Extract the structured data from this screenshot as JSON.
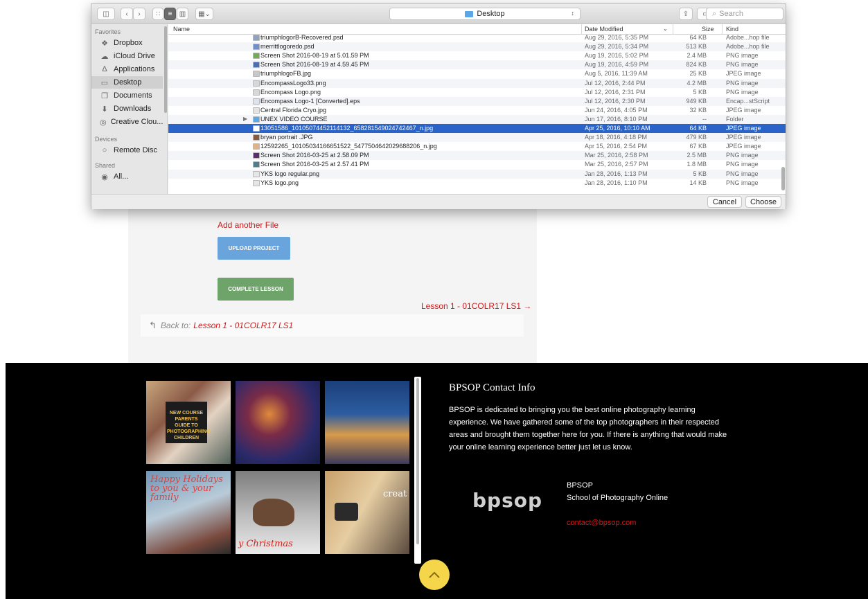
{
  "dialog": {
    "location": "Desktop",
    "search_placeholder": "Search",
    "sidebar": {
      "favorites_header": "Favorites",
      "favorites": [
        "Dropbox",
        "iCloud Drive",
        "Applications",
        "Desktop",
        "Documents",
        "Downloads",
        "Creative Clou..."
      ],
      "devices_header": "Devices",
      "devices": [
        "Remote Disc"
      ],
      "shared_header": "Shared",
      "shared": [
        "All..."
      ]
    },
    "columns": {
      "name": "Name",
      "date": "Date Modified",
      "size": "Size",
      "kind": "Kind"
    },
    "files": [
      {
        "name": "triumphlogorB-Recovered.psd",
        "date": "Aug 29, 2016, 5:35 PM",
        "size": "64 KB",
        "kind": "Adobe...hop file",
        "color": "#8fa3c0"
      },
      {
        "name": "merrittlogoredo.psd",
        "date": "Aug 29, 2016, 5:34 PM",
        "size": "513 KB",
        "kind": "Adobe...hop file",
        "color": "#6f8fc6"
      },
      {
        "name": "Screen Shot 2016-08-19 at 5.01.59 PM",
        "date": "Aug 19, 2016, 5:02 PM",
        "size": "2.4 MB",
        "kind": "PNG image",
        "color": "#6fae57"
      },
      {
        "name": "Screen Shot 2016-08-19 at 4.59.45 PM",
        "date": "Aug 19, 2016, 4:59 PM",
        "size": "824 KB",
        "kind": "PNG image",
        "color": "#4a6fb0"
      },
      {
        "name": "triumphlogoFB.jpg",
        "date": "Aug 5, 2016, 11:39 AM",
        "size": "25 KB",
        "kind": "JPEG image",
        "color": "#c8c8c8"
      },
      {
        "name": "EncompassLogo33.png",
        "date": "Jul 12, 2016, 2:44 PM",
        "size": "4.2 MB",
        "kind": "PNG image",
        "color": "#d8d8d8"
      },
      {
        "name": "Encompass Logo.png",
        "date": "Jul 12, 2016, 2:31 PM",
        "size": "5 KB",
        "kind": "PNG image",
        "color": "#d8d8d8"
      },
      {
        "name": "Encompass Logo-1 [Converted].eps",
        "date": "Jul 12, 2016, 2:30 PM",
        "size": "949 KB",
        "kind": "Encap...stScript",
        "color": "#dde3ee"
      },
      {
        "name": "Central Florida Cryo.jpg",
        "date": "Jun 24, 2016, 4:05 PM",
        "size": "32 KB",
        "kind": "JPEG image",
        "color": "#e3e3e3"
      },
      {
        "name": "UNEX VIDEO COURSE",
        "date": "Jun 17, 2016, 8:10 PM",
        "size": "--",
        "kind": "Folder",
        "color": "#5aa9e6",
        "folder": true
      },
      {
        "name": "13051586_10105074452114132_658281549024742467_n.jpg",
        "date": "Apr 25, 2016, 10:10 AM",
        "size": "64 KB",
        "kind": "JPEG image",
        "color": "#ffffff",
        "selected": true
      },
      {
        "name": "bryan portrait .JPG",
        "date": "Apr 18, 2016, 4:18 PM",
        "size": "479 KB",
        "kind": "JPEG image",
        "color": "#8a5a3a"
      },
      {
        "name": "12592265_10105034166651522_5477504642029688206_n.jpg",
        "date": "Apr 15, 2016, 2:54 PM",
        "size": "67 KB",
        "kind": "JPEG image",
        "color": "#e0b28a"
      },
      {
        "name": "Screen Shot 2016-03-25 at 2.58.09 PM",
        "date": "Mar 25, 2016, 2:58 PM",
        "size": "2.5 MB",
        "kind": "PNG image",
        "color": "#5a2f6b"
      },
      {
        "name": "Screen Shot 2016-03-25 at 2.57.41 PM",
        "date": "Mar 25, 2016, 2:57 PM",
        "size": "1.8 MB",
        "kind": "PNG image",
        "color": "#4f7d88"
      },
      {
        "name": "YKS logo regular.png",
        "date": "Jan 28, 2016, 1:13 PM",
        "size": "5 KB",
        "kind": "PNG image",
        "color": "#e6e6e6"
      },
      {
        "name": "YKS logo.png",
        "date": "Jan 28, 2016, 1:10 PM",
        "size": "14 KB",
        "kind": "PNG image",
        "color": "#e6e6e6"
      }
    ],
    "cancel": "Cancel",
    "choose": "Choose"
  },
  "page": {
    "add_file": "Add another File",
    "upload": "UPLOAD PROJECT",
    "complete": "COMPLETE LESSON",
    "next_lesson": "Lesson 1 - 01COLR17 LS1 →",
    "back_prefix": "Back to:",
    "back_link": "Lesson 1 - 01COLR17 LS1"
  },
  "footer": {
    "gallery": [
      {
        "caption": "NEW COURSE PARENTS GUIDE TO PHOTOGRAPHING CHILDREN"
      },
      {
        "caption": ""
      },
      {
        "caption": ""
      },
      {
        "caption": "Happy Holidays to you & your family"
      },
      {
        "caption": "y Christmas"
      },
      {
        "caption": "creat"
      }
    ],
    "contact_title": "BPSOP Contact Info",
    "contact_body": "BPSOP is dedicated to bringing you the best online photography learning experience. We have gathered some of the top photographers in their respected areas and brought them together here for you. If there is anything that would make your online learning experience better just let us know.",
    "logo": "bpsop",
    "org_name": "BPSOP",
    "org_sub": "School of Photography Online",
    "email": "contact@bpsop.com"
  }
}
